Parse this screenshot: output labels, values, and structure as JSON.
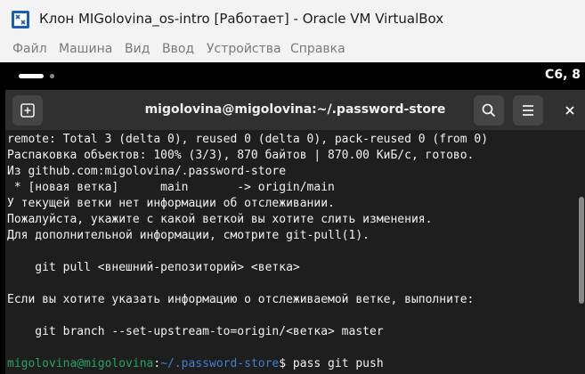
{
  "window": {
    "title": "Клон MIGolovina_os-intro [Работает] - Oracle VM VirtualBox"
  },
  "menubar": {
    "items": [
      "Файл",
      "Машина",
      "Вид",
      "Ввод",
      "Устройства",
      "Справка"
    ]
  },
  "guest_panel": {
    "clock": "С6, 8"
  },
  "terminal": {
    "title": "migolovina@migolovina:~/.password-store",
    "lines": [
      "remote: Total 3 (delta 0), reused 0 (delta 0), pack-reused 0 (from 0)",
      "Распаковка объектов: 100% (3/3), 870 байтов | 870.00 КиБ/с, готово.",
      "Из github.com:migolovina/.password-store",
      " * [новая ветка]      main       -> origin/main",
      "У текущей ветки нет информации об отслеживании.",
      "Пожалуйста, укажите с какой веткой вы хотите слить изменения.",
      "Для дополнительной информации, смотрите git-pull(1).",
      "",
      "    git pull <внешний-репозиторий> <ветка>",
      "",
      "Если вы хотите указать информацию о отслеживаемой ветке, выполните:",
      "",
      "    git branch --set-upstream-to=origin/<ветка> master",
      ""
    ],
    "prompt": {
      "user_host": "migolovina@migolovina",
      "separator": ":",
      "path": "~/.password-store",
      "symbol": "$",
      "command": " pass git push"
    }
  },
  "colors": {
    "prompt_user": "#26a269",
    "prompt_path": "#3f7fd0",
    "terminal_bg": "#1e1e1e",
    "header_bg": "#303030"
  }
}
